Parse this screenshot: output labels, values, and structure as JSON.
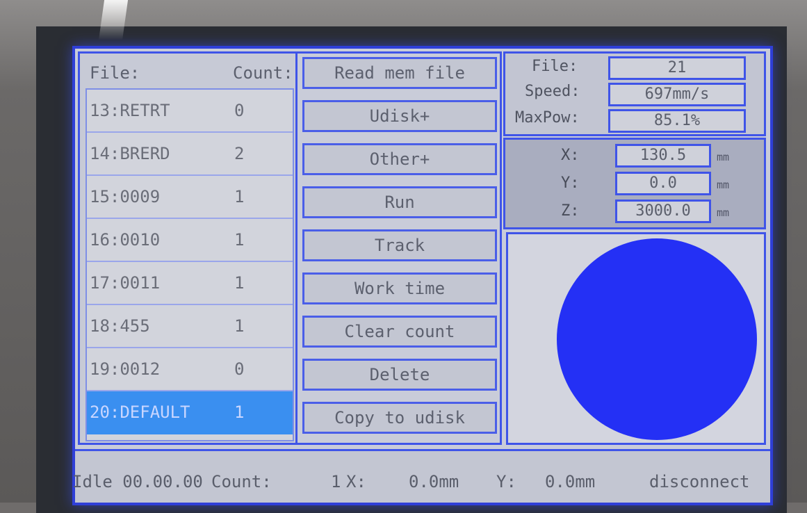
{
  "file_panel": {
    "header_file": "File:",
    "header_count": "Count:",
    "rows": [
      {
        "name": "13:RETRT",
        "count": "0"
      },
      {
        "name": "14:BRERD",
        "count": "2"
      },
      {
        "name": "15:0009",
        "count": "1"
      },
      {
        "name": "16:0010",
        "count": "1"
      },
      {
        "name": "17:0011",
        "count": "1"
      },
      {
        "name": "18:455",
        "count": "1"
      },
      {
        "name": "19:0012",
        "count": "0"
      },
      {
        "name": "20:DEFAULT",
        "count": "1"
      }
    ]
  },
  "buttons": [
    "Read mem file",
    "Udisk+",
    "Other+",
    "Run",
    "Track",
    "Work time",
    "Clear count",
    "Delete",
    "Copy to udisk"
  ],
  "info": {
    "file_label": "File:",
    "file_value": "21",
    "speed_label": "Speed:",
    "speed_value": "697mm/s",
    "maxpow_label": "MaxPow:",
    "maxpow_value": "85.1%"
  },
  "coords": {
    "x_label": "X:",
    "x_value": "130.5",
    "y_label": "Y:",
    "y_value": "0.0",
    "z_label": "Z:",
    "z_value": "3000.0",
    "unit": "mm"
  },
  "status": {
    "state": "Idle 00.00.00",
    "count_label": "Count:",
    "count_value": "1",
    "x_label": "X:",
    "x_value": "0.0mm",
    "y_label": "Y:",
    "y_value": "0.0mm",
    "connection": "disconnect"
  },
  "colors": {
    "frame_blue": "#3f54e8",
    "selected_row": "#3a8ff0",
    "preview_shape": "#2430f5"
  }
}
